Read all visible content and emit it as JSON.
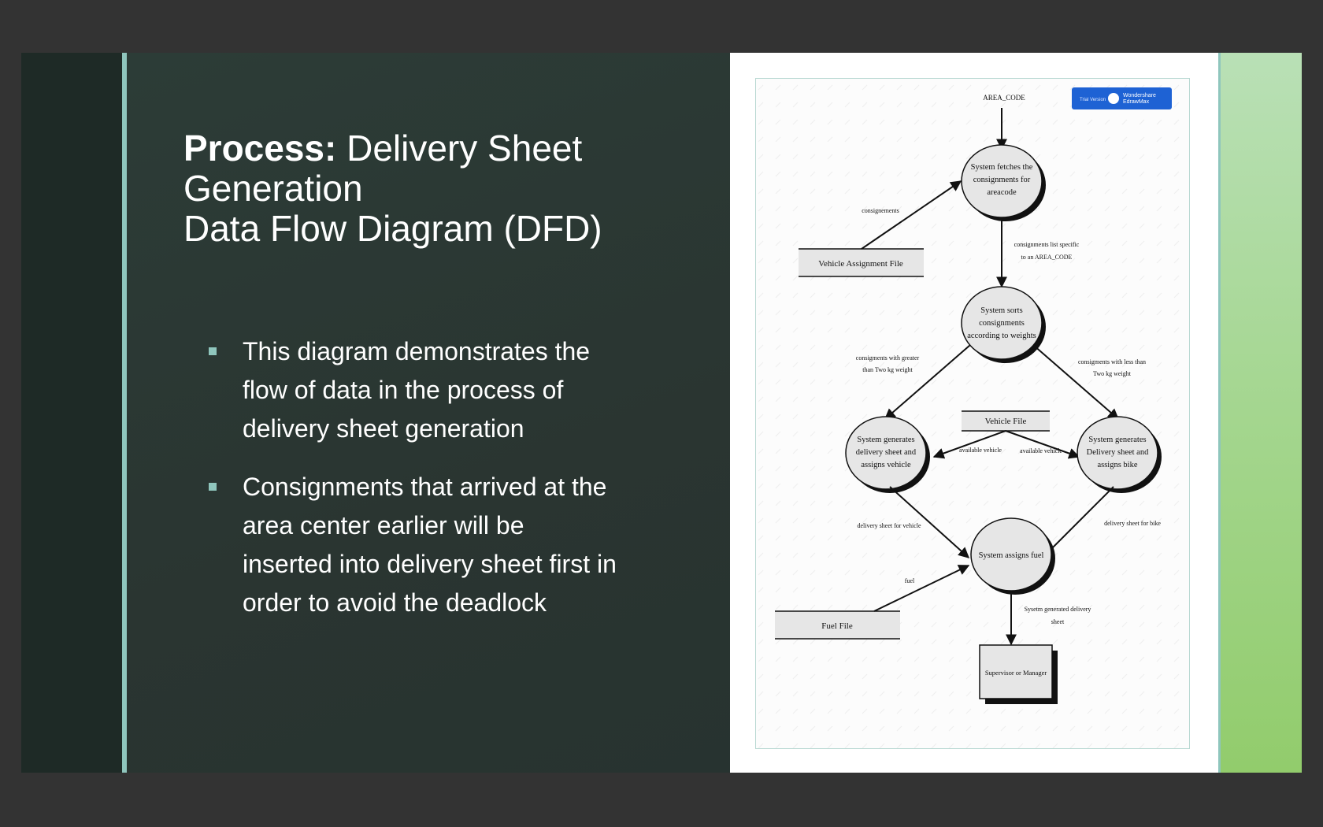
{
  "slide": {
    "title_bold": "Process:",
    "title_line1": " Delivery Sheet",
    "title_line2": "Generation",
    "title_line3": "Data Flow Diagram (DFD)",
    "bullets": [
      "This diagram demonstrates the flow of data in the process of delivery sheet generation",
      "Consignments that arrived at the area center earlier will be inserted into delivery sheet first in order to avoid the deadlock"
    ]
  },
  "diagram": {
    "watermark": {
      "tag": "Trial Version",
      "brand1": "Wondershare",
      "brand2": "EdrawMax"
    },
    "external_input": "AREA_CODE",
    "processes": {
      "fetch": [
        "System fetches the",
        "consignments for",
        "areacode"
      ],
      "sort": [
        "System sorts",
        "consignments",
        "according to weights"
      ],
      "vehicle": [
        "System generates",
        "delivery sheet and",
        "assigns vehicle"
      ],
      "bike": [
        "System generates",
        "Delivery sheet and",
        "assigns bike"
      ],
      "fuel": [
        "System assigns fuel"
      ]
    },
    "stores": {
      "vehicle_assignment": "Vehicle Assignment File",
      "vehicle_file": "Vehicle File",
      "fuel_file": "Fuel File"
    },
    "entity": "Supervisor or Manager",
    "flows": {
      "consignments": "consignements",
      "list_specific": [
        "consignments list specific",
        "to an AREA_CODE"
      ],
      "greater": [
        "consigments with greater",
        "than Two kg weight"
      ],
      "less": [
        "consigments with less than",
        "Two kg weight"
      ],
      "avail_left": "available vehicle",
      "avail_right": "available vehicle",
      "sheet_vehicle": "delivery sheet for vehicle",
      "sheet_bike": "delivery sheet for bike",
      "fuel": "fuel",
      "generated": [
        "Sysetm generated delivery",
        "sheet"
      ]
    }
  }
}
